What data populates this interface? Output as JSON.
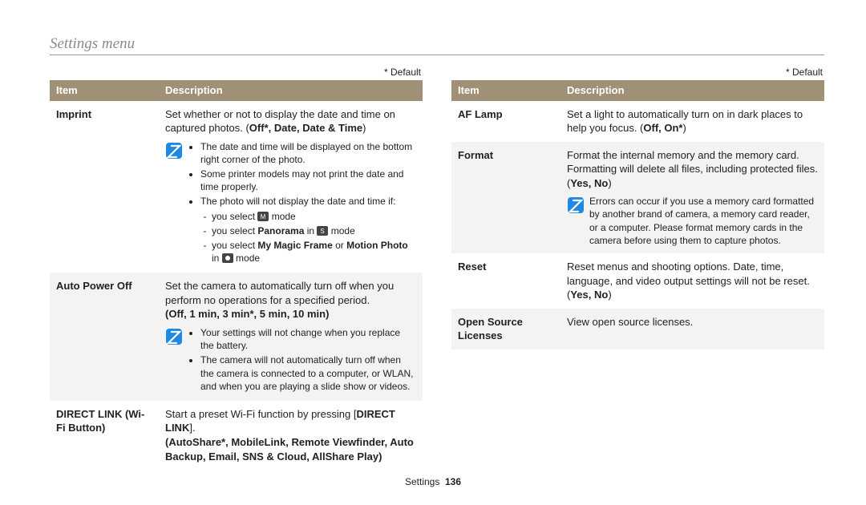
{
  "page_title": "Settings menu",
  "default_marker": "* Default",
  "headers": {
    "item": "Item",
    "description": "Description"
  },
  "left_rows": [
    {
      "item": "Imprint",
      "desc_lead": "Set whether or not to display the date and time on captured photos. (",
      "desc_opts": "Off*, Date, Date & Time",
      "desc_trail": ")",
      "note_bullets": [
        "The date and time will be displayed on the bottom right corner of the photo.",
        "Some printer models may not print the date and time properly.",
        "The photo will not display the date and time if:"
      ],
      "sub_bullets": {
        "s1a": "you select ",
        "s1b": " mode",
        "s2a": "you select ",
        "s2b": "Panorama",
        "s2c": " in ",
        "s2d": " mode",
        "s3a": "you select ",
        "s3b": "My Magic Frame",
        "s3c": " or ",
        "s3d": "Motion Photo",
        "s3e": " in ",
        "s3f": " mode"
      }
    },
    {
      "item": "Auto Power Off",
      "desc_lead": "Set the camera to automatically turn off when you perform no operations for a specified period.",
      "opts_line": "(Off, 1 min, 3 min*, 5 min, 10 min)",
      "note_bullets": [
        "Your settings will not change when you replace the battery.",
        "The camera will not automatically turn off when the camera is connected to a computer, or WLAN, and when you are playing a slide show or videos."
      ]
    },
    {
      "item": "DIRECT LINK (Wi-Fi Button)",
      "line1a": "Start a preset Wi-Fi function by pressing [",
      "line1b": "DIRECT LINK",
      "line1c": "].",
      "line2": "(AutoShare*, MobileLink, Remote Viewfinder, Auto Backup, Email, SNS & Cloud, AllShare Play)"
    }
  ],
  "right_rows": [
    {
      "item": "AF Lamp",
      "desc_lead": "Set a light to automatically turn on in dark places to help you focus. (",
      "desc_opts": "Off, On*",
      "desc_trail": ")"
    },
    {
      "item": "Format",
      "desc_lead": "Format the internal memory and the memory card. Formatting will delete all files, including protected files. (",
      "desc_opts": "Yes, No",
      "desc_trail": ")",
      "note_single": "Errors can occur if you use a memory card formatted by another brand of camera, a memory card reader, or a computer. Please format memory cards in the camera before using them to capture photos."
    },
    {
      "item": "Reset",
      "desc_lead": "Reset menus and shooting options. Date, time, language, and video output settings will not be reset. (",
      "desc_opts": "Yes, No",
      "desc_trail": ")"
    },
    {
      "item": "Open Source Licenses",
      "desc_lead": "View open source licenses."
    }
  ],
  "footer": {
    "section": "Settings",
    "page": "136"
  }
}
